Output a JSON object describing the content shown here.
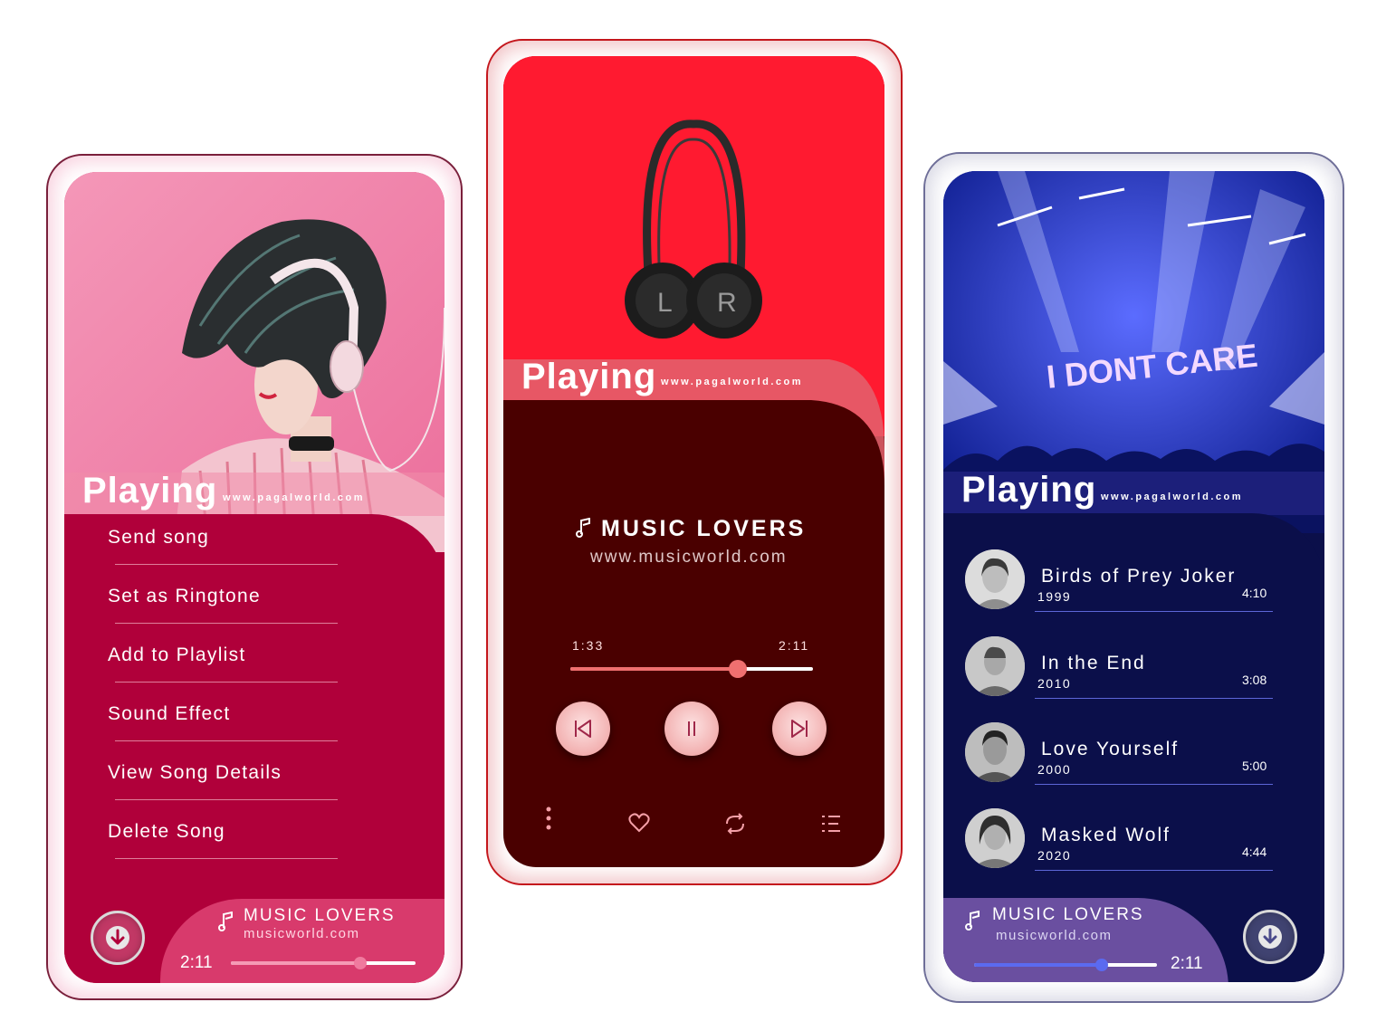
{
  "playing_label": "Playing",
  "site_small": "www.pagalworld.com",
  "phone1": {
    "menu": [
      "Send song",
      "Set as Ringtone",
      "Add to Playlist",
      "Sound Effect",
      "View Song Details",
      "Delete Song"
    ],
    "mini_player": {
      "title": "MUSIC LOVERS",
      "site": "musicworld.com",
      "time": "2:11",
      "progress": 0.7
    }
  },
  "phone2": {
    "title": "MUSIC LOVERS",
    "site": "www.musicworld.com",
    "elapsed": "1:33",
    "total": "2:11",
    "progress": 0.69,
    "headphone_left": "L",
    "headphone_right": "R"
  },
  "phone3": {
    "stage_text": "I DONT CARE",
    "songs": [
      {
        "name": "Birds of Prey Joker",
        "year": "1999",
        "duration": "4:10"
      },
      {
        "name": "In the End",
        "year": "2010",
        "duration": "3:08"
      },
      {
        "name": "Love Yourself",
        "year": "2000",
        "duration": "5:00"
      },
      {
        "name": "Masked Wolf",
        "year": "2020",
        "duration": "4:44"
      }
    ],
    "mini_player": {
      "title": "MUSIC LOVERS",
      "site": "musicworld.com",
      "time": "2:11",
      "progress": 0.7
    }
  },
  "colors": {
    "phone1_primary": "#b0003a",
    "phone1_accent": "#d83a6c",
    "phone2_primary": "#ff1a30",
    "phone2_dark": "#4a0000",
    "phone2_progress": "#f07070",
    "phone3_primary": "#0b0f4a",
    "phone3_accent": "#6a4fa0",
    "phone3_progress": "#5b6af0"
  }
}
